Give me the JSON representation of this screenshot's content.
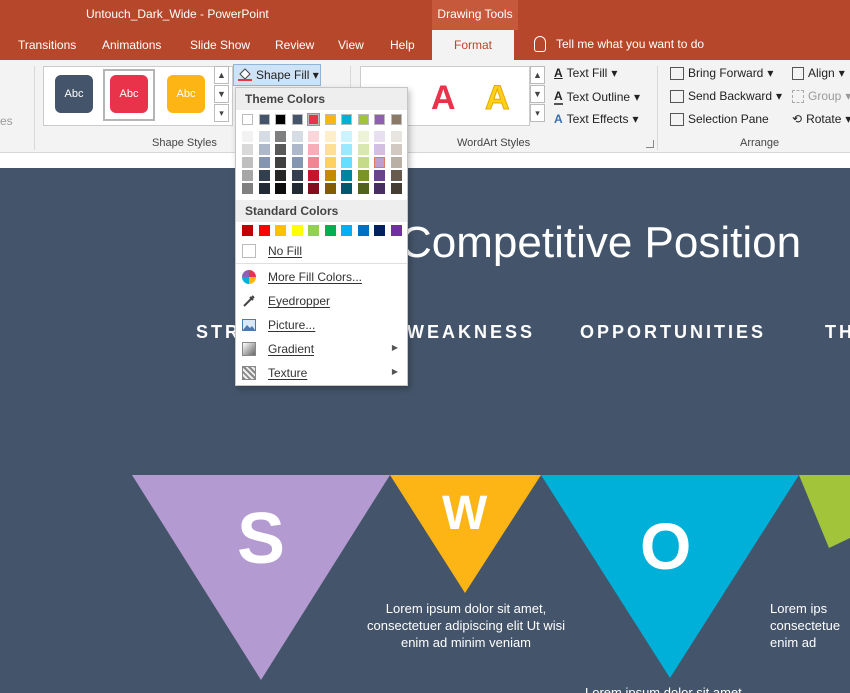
{
  "window": {
    "title": "Untouch_Dark_Wide  -  PowerPoint",
    "context_group": "Drawing Tools"
  },
  "tabs": [
    "Transitions",
    "Animations",
    "Slide Show",
    "Review",
    "View",
    "Help",
    "Format"
  ],
  "active_tab": "Format",
  "tell_me": "Tell me what you want to do",
  "ribbon": {
    "shape_styles": {
      "label": "Shape Styles",
      "presets": [
        {
          "text": "Abc",
          "color": "#44546a"
        },
        {
          "text": "Abc",
          "color": "#e8334a"
        },
        {
          "text": "Abc",
          "color": "#fcb514"
        }
      ],
      "shape_fill": "Shape Fill",
      "partial_left": "es"
    },
    "wordart_styles": {
      "label": "WordArt Styles",
      "letters": [
        {
          "text": "A",
          "color": "#e8334a"
        },
        {
          "text": "A",
          "color": "#fcd116"
        }
      ],
      "text_fill": "Text Fill",
      "text_outline": "Text Outline",
      "text_effects": "Text Effects"
    },
    "arrange": {
      "label": "Arrange",
      "bring_forward": "Bring Forward",
      "send_backward": "Send Backward",
      "selection_pane": "Selection Pane",
      "align": "Align",
      "group": "Group",
      "rotate": "Rotate"
    }
  },
  "dropdown": {
    "theme_colors_header": "Theme Colors",
    "standard_colors_header": "Standard Colors",
    "theme_top_row": [
      "#ffffff",
      "#44546a",
      "#000000",
      "#44546a",
      "#e8334a",
      "#fcb514",
      "#00b0d8",
      "#a1c43a",
      "#8e5fb4",
      "#8b7a68"
    ],
    "theme_shades": [
      [
        "#f2f2f2",
        "#d9d9d9",
        "#bfbfbf",
        "#a6a6a6",
        "#808080"
      ],
      [
        "#d6dce4",
        "#adb9ca",
        "#8496b0",
        "#333f4f",
        "#222a35"
      ],
      [
        "#7f7f7f",
        "#595959",
        "#404040",
        "#262626",
        "#0d0d0d"
      ],
      [
        "#d6dce4",
        "#adb9ca",
        "#8496b0",
        "#333f4f",
        "#222a35"
      ],
      [
        "#fad6db",
        "#f6adb7",
        "#f18593",
        "#c5142b",
        "#830d1d"
      ],
      [
        "#feefca",
        "#fee095",
        "#fdd061",
        "#c48a02",
        "#835c01"
      ],
      [
        "#ccf4ff",
        "#99e9ff",
        "#66deff",
        "#0084a2",
        "#00586c"
      ],
      [
        "#ecf3d7",
        "#d9e7b0",
        "#c6db89",
        "#7a9429",
        "#51621b"
      ],
      [
        "#e8dff0",
        "#d2bfe1",
        "#bb9fd2",
        "#6a4390",
        "#472d60"
      ],
      [
        "#e8e4e0",
        "#d1c9c2",
        "#b9afa4",
        "#685b4e",
        "#453d34"
      ]
    ],
    "standard_colors": [
      "#c00000",
      "#ff0000",
      "#ffc000",
      "#ffff00",
      "#92d050",
      "#00b050",
      "#00b0f0",
      "#0070c0",
      "#002060",
      "#7030a0"
    ],
    "no_fill": "No Fill",
    "more_fill_colors": "More Fill Colors...",
    "eyedropper": "Eyedropper",
    "picture": "Picture...",
    "gradient": "Gradient",
    "texture": "Texture"
  },
  "slide": {
    "title": "Competitive Position",
    "headings": [
      "STR",
      "WEAKNESS",
      "OPPORTUNITIES",
      "TH"
    ],
    "letters": [
      "S",
      "W",
      "O"
    ],
    "colors": {
      "background": "#44546a",
      "s": "#b39ad0",
      "w": "#fcb514",
      "o": "#00b0d8",
      "t": "#a1c43a"
    },
    "body_w": "Lorem ipsum dolor sit amet, consectetuer adipiscing elit Ut wisi enim ad minim veniam",
    "body_t": "Lorem ips consectetue enim ad",
    "body_o": "Lorem ipsum dolor sit amet"
  }
}
